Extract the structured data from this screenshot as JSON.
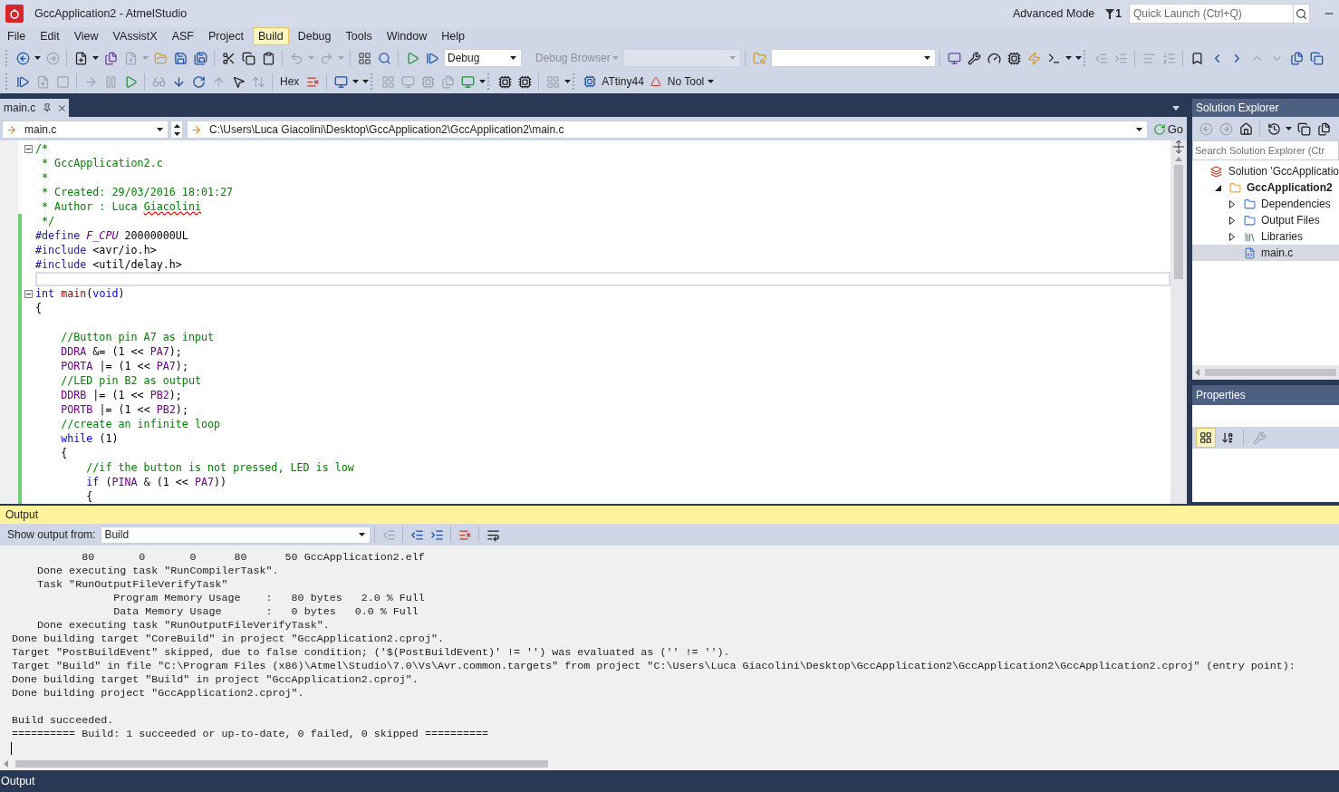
{
  "window": {
    "title": "GccApplication2 - AtmelStudio",
    "mode": "Advanced Mode",
    "notifications": "1",
    "quick_launch": {
      "placeholder": "Quick Launch (Ctrl+Q)"
    }
  },
  "menu": [
    {
      "label": "File",
      "selected": false
    },
    {
      "label": "Edit",
      "selected": false
    },
    {
      "label": "View",
      "selected": false
    },
    {
      "label": "VAssistX",
      "selected": false
    },
    {
      "label": "ASF",
      "selected": false
    },
    {
      "label": "Project",
      "selected": false
    },
    {
      "label": "Build",
      "selected": true
    },
    {
      "label": "Debug",
      "selected": false
    },
    {
      "label": "Tools",
      "selected": false
    },
    {
      "label": "Window",
      "selected": false
    },
    {
      "label": "Help",
      "selected": false
    }
  ],
  "toolbar": {
    "configuration": "Debug",
    "browser": "Debug Browser",
    "hex": "Hex",
    "device": "ATtiny44",
    "tool": "No Tool"
  },
  "editor": {
    "tab": "main.c",
    "file_dropdown": "main.c",
    "path": "C:\\Users\\Luca Giacolini\\Desktop\\GccApplication2\\GccApplication2\\main.c",
    "go": "Go",
    "lines": [
      {
        "fold": true,
        "modified": false,
        "current": false,
        "tokens": [
          {
            "text": "/*",
            "kind": "comment"
          }
        ]
      },
      {
        "fold": false,
        "modified": false,
        "current": false,
        "tokens": [
          {
            "text": " * GccApplication2.c",
            "kind": "comment"
          }
        ]
      },
      {
        "fold": false,
        "modified": false,
        "current": false,
        "tokens": [
          {
            "text": " *",
            "kind": "comment"
          }
        ]
      },
      {
        "fold": false,
        "modified": false,
        "current": false,
        "tokens": [
          {
            "text": " * Created: 29/03/2016 18:01:27",
            "kind": "comment"
          }
        ]
      },
      {
        "fold": false,
        "modified": false,
        "current": false,
        "tokens": [
          {
            "text": " * Author : Luca ",
            "kind": "comment"
          },
          {
            "text": "Giacolini",
            "kind": "misspelled"
          }
        ]
      },
      {
        "fold": false,
        "modified": true,
        "current": false,
        "tokens": [
          {
            "text": " */",
            "kind": "comment"
          }
        ]
      },
      {
        "fold": false,
        "modified": true,
        "current": false,
        "tokens": [
          {
            "text": "#define ",
            "kind": "preproc"
          },
          {
            "text": "F_CPU",
            "kind": "macro"
          },
          {
            "text": " 20000000UL",
            "kind": "plain"
          }
        ]
      },
      {
        "fold": false,
        "modified": true,
        "current": false,
        "tokens": [
          {
            "text": "#include",
            "kind": "preproc"
          },
          {
            "text": " <avr/io.h>",
            "kind": "plain"
          }
        ]
      },
      {
        "fold": false,
        "modified": true,
        "current": false,
        "tokens": [
          {
            "text": "#include",
            "kind": "preproc"
          },
          {
            "text": " <util/delay.h>",
            "kind": "plain"
          }
        ]
      },
      {
        "fold": false,
        "modified": true,
        "current": true
      },
      {
        "fold": true,
        "modified": true,
        "current": false,
        "tokens": [
          {
            "text": "int ",
            "kind": "keyword"
          },
          {
            "text": "main",
            "kind": "function"
          },
          {
            "text": "(",
            "kind": "plain"
          },
          {
            "text": "void",
            "kind": "keyword"
          },
          {
            "text": ")",
            "kind": "plain"
          }
        ]
      },
      {
        "fold": false,
        "modified": true,
        "current": false,
        "tokens": [
          {
            "text": "{",
            "kind": "plain"
          }
        ]
      },
      {
        "fold": false,
        "modified": true,
        "current": false
      },
      {
        "fold": false,
        "modified": true,
        "current": false,
        "tokens": [
          {
            "text": "    //Button pin A7 as input",
            "kind": "comment"
          }
        ]
      },
      {
        "fold": false,
        "modified": true,
        "current": false,
        "tokens": [
          {
            "text": "    DDRA",
            "kind": "identifier"
          },
          {
            "text": " &= (1 << ",
            "kind": "plain"
          },
          {
            "text": "PA7",
            "kind": "identifier"
          },
          {
            "text": ");",
            "kind": "plain"
          }
        ]
      },
      {
        "fold": false,
        "modified": true,
        "current": false,
        "tokens": [
          {
            "text": "    PORTA",
            "kind": "identifier"
          },
          {
            "text": " |= (1 << ",
            "kind": "plain"
          },
          {
            "text": "PA7",
            "kind": "identifier"
          },
          {
            "text": ");",
            "kind": "plain"
          }
        ]
      },
      {
        "fold": false,
        "modified": true,
        "current": false,
        "tokens": [
          {
            "text": "    //LED pin B2 as output",
            "kind": "comment"
          }
        ]
      },
      {
        "fold": false,
        "modified": true,
        "current": false,
        "tokens": [
          {
            "text": "    DDRB",
            "kind": "identifier"
          },
          {
            "text": " |= (1 << ",
            "kind": "plain"
          },
          {
            "text": "PB2",
            "kind": "identifier"
          },
          {
            "text": ");",
            "kind": "plain"
          }
        ]
      },
      {
        "fold": false,
        "modified": true,
        "current": false,
        "tokens": [
          {
            "text": "    PORTB",
            "kind": "identifier"
          },
          {
            "text": " |= (1 << ",
            "kind": "plain"
          },
          {
            "text": "PB2",
            "kind": "identifier"
          },
          {
            "text": ");",
            "kind": "plain"
          }
        ]
      },
      {
        "fold": false,
        "modified": true,
        "current": false,
        "tokens": [
          {
            "text": "    //create an infinite loop",
            "kind": "comment"
          }
        ]
      },
      {
        "fold": false,
        "modified": true,
        "current": false,
        "tokens": [
          {
            "text": "    while",
            "kind": "keyword"
          },
          {
            "text": " (1)",
            "kind": "plain"
          }
        ]
      },
      {
        "fold": false,
        "modified": true,
        "current": false,
        "tokens": [
          {
            "text": "    {",
            "kind": "plain"
          }
        ]
      },
      {
        "fold": false,
        "modified": true,
        "current": false,
        "tokens": [
          {
            "text": "        //if the button is not pressed, LED is low",
            "kind": "comment"
          }
        ]
      },
      {
        "fold": false,
        "modified": true,
        "current": false,
        "tokens": [
          {
            "text": "        if",
            "kind": "keyword"
          },
          {
            "text": " (",
            "kind": "plain"
          },
          {
            "text": "PINA",
            "kind": "identifier"
          },
          {
            "text": " & (1 << ",
            "kind": "plain"
          },
          {
            "text": "PA7",
            "kind": "identifier"
          },
          {
            "text": "))",
            "kind": "plain"
          }
        ]
      },
      {
        "fold": false,
        "modified": true,
        "current": false,
        "tokens": [
          {
            "text": "        {",
            "kind": "plain"
          }
        ]
      }
    ]
  },
  "solution_explorer": {
    "title": "Solution Explorer",
    "search": {
      "placeholder": "Search Solution Explorer (Ctr"
    },
    "tree": [
      {
        "label": "Solution 'GccApplicatio",
        "kind": "solution",
        "bold": false,
        "selected": false,
        "children": [
          {
            "label": "GccApplication2",
            "kind": "project",
            "bold": true,
            "selected": false,
            "expanded": true,
            "children": [
              {
                "label": "Dependencies",
                "kind": "folder",
                "bold": false,
                "selected": false,
                "expanded": false
              },
              {
                "label": "Output Files",
                "kind": "folder",
                "bold": false,
                "selected": false,
                "expanded": false
              },
              {
                "label": "Libraries",
                "kind": "library",
                "bold": false,
                "selected": false,
                "expanded": false
              },
              {
                "label": "main.c",
                "kind": "file",
                "bold": false,
                "selected": true
              }
            ]
          }
        ]
      }
    ]
  },
  "properties": {
    "title": "Properties",
    "view_buttons": [
      {
        "kind": "categorized",
        "selected": true
      },
      {
        "kind": "alphabetical",
        "selected": false
      }
    ]
  },
  "output": {
    "title": "Output",
    "source_label": "Show output from:",
    "source": "Build",
    "groups": [
      [
        "           80       0       0      80      50 GccApplication2.elf",
        "    Done executing task \"RunCompilerTask\".",
        "    Task \"RunOutputFileVerifyTask\"",
        "                Program Memory Usage    :   80 bytes   2.0 % Full",
        "                Data Memory Usage       :   0 bytes   0.0 % Full",
        "    Done executing task \"RunOutputFileVerifyTask\".",
        "Done building target \"CoreBuild\" in project \"GccApplication2.cproj\".",
        "Target \"PostBuildEvent\" skipped, due to false condition; ('$(PostBuildEvent)' != '') was evaluated as ('' != '').",
        "Target \"Build\" in file \"C:\\Program Files (x86)\\Atmel\\Studio\\7.0\\Vs\\Avr.common.targets\" from project \"C:\\Users\\Luca Giacolini\\Desktop\\GccApplication2\\GccApplication2\\GccApplication2.cproj\" (entry point):",
        "Done building target \"Build\" in project \"GccApplication2.cproj\".",
        "Done building project \"GccApplication2.cproj\"."
      ],
      [
        "Build succeeded.",
        "========== Build: 1 succeeded or up-to-date, 0 failed, 0 skipped =========="
      ]
    ]
  },
  "status_bar": {
    "text": "Output"
  }
}
